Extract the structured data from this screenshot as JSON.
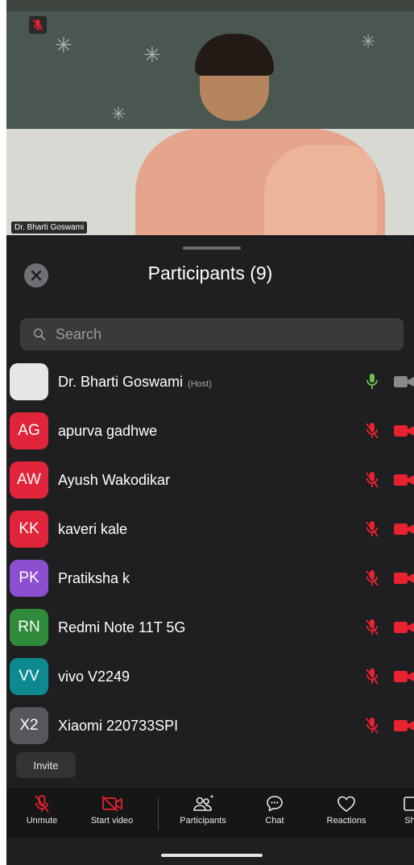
{
  "video": {
    "speaker_name": "Dr. Bharti Goswami"
  },
  "panel": {
    "title": "Participants (9)",
    "search_placeholder": "Search"
  },
  "participants": [
    {
      "initials": "",
      "name": "Dr. Bharti Goswami",
      "tag": "(Host)",
      "avatar_color": "#e6e6e6",
      "mic": "on",
      "video": "off"
    },
    {
      "initials": "AG",
      "name": "apurva gadhwe",
      "tag": "",
      "avatar_color": "#e0243a",
      "mic": "muted",
      "video": "off"
    },
    {
      "initials": "AW",
      "name": "Ayush Wakodikar",
      "tag": "",
      "avatar_color": "#e0243a",
      "mic": "muted",
      "video": "off"
    },
    {
      "initials": "KK",
      "name": "kaveri kale",
      "tag": "",
      "avatar_color": "#e0243a",
      "mic": "muted",
      "video": "off"
    },
    {
      "initials": "PK",
      "name": "Pratiksha k",
      "tag": "",
      "avatar_color": "#8b4fcf",
      "mic": "muted",
      "video": "off"
    },
    {
      "initials": "RN",
      "name": "Redmi Note 11T 5G",
      "tag": "",
      "avatar_color": "#2f8a3a",
      "mic": "muted",
      "video": "off"
    },
    {
      "initials": "VV",
      "name": "vivo V2249",
      "tag": "",
      "avatar_color": "#0d8a8f",
      "mic": "muted",
      "video": "off"
    },
    {
      "initials": "X2",
      "name": "Xiaomi 220733SPI",
      "tag": "",
      "avatar_color": "#55575c",
      "mic": "muted",
      "video": "off"
    }
  ],
  "invite_label": "Invite",
  "toolbar": {
    "unmute": "Unmute",
    "start_video": "Start video",
    "participants": "Participants",
    "chat": "Chat",
    "reactions": "Reactions",
    "share": "Sh"
  },
  "colors": {
    "muted_red": "#e8232f",
    "mic_on_green": "#6ec04a",
    "sheet_bg": "#1f1f21"
  }
}
